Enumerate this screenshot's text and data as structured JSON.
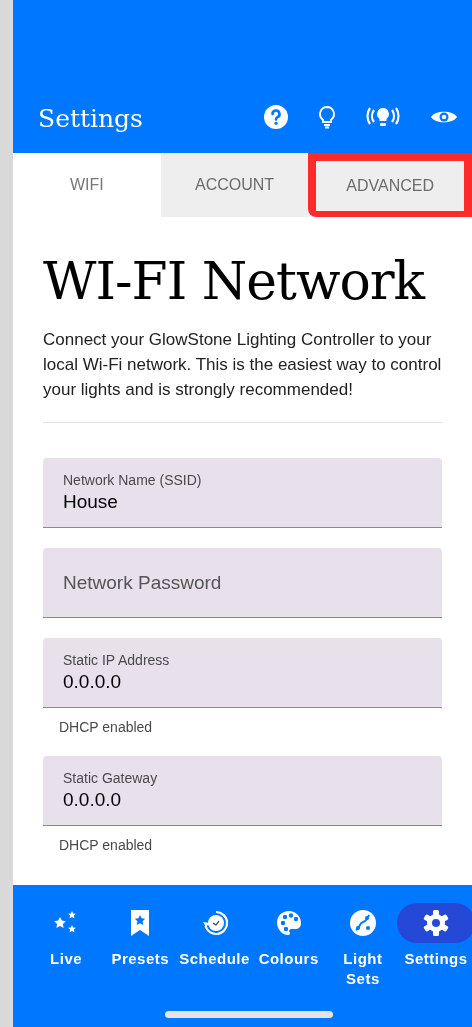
{
  "header": {
    "title": "Settings"
  },
  "tabs": [
    {
      "label": "WIFI",
      "selected": true,
      "highlighted": false
    },
    {
      "label": "ACCOUNT",
      "selected": false,
      "highlighted": false
    },
    {
      "label": "ADVANCED",
      "selected": false,
      "highlighted": true
    }
  ],
  "heading": "WI-FI Network",
  "description": "Connect your GlowStone Lighting Controller to your local Wi-Fi network. This is the easiest way to control your lights and is strongly recommended!",
  "fields": [
    {
      "label": "Network Name (SSID)",
      "value": "House"
    },
    {
      "placeholder": "Network Password"
    },
    {
      "label": "Static IP Address",
      "value": "0.0.0.0",
      "helper": "DHCP enabled"
    },
    {
      "label": "Static Gateway",
      "value": "0.0.0.0",
      "helper": "DHCP enabled"
    }
  ],
  "nav": [
    {
      "label": "Live",
      "selected": false
    },
    {
      "label": "Presets",
      "selected": false
    },
    {
      "label": "Schedule",
      "selected": false
    },
    {
      "label": "Colours",
      "selected": false
    },
    {
      "label": "Light Sets",
      "selected": false
    },
    {
      "label": "Settings",
      "selected": true
    }
  ]
}
